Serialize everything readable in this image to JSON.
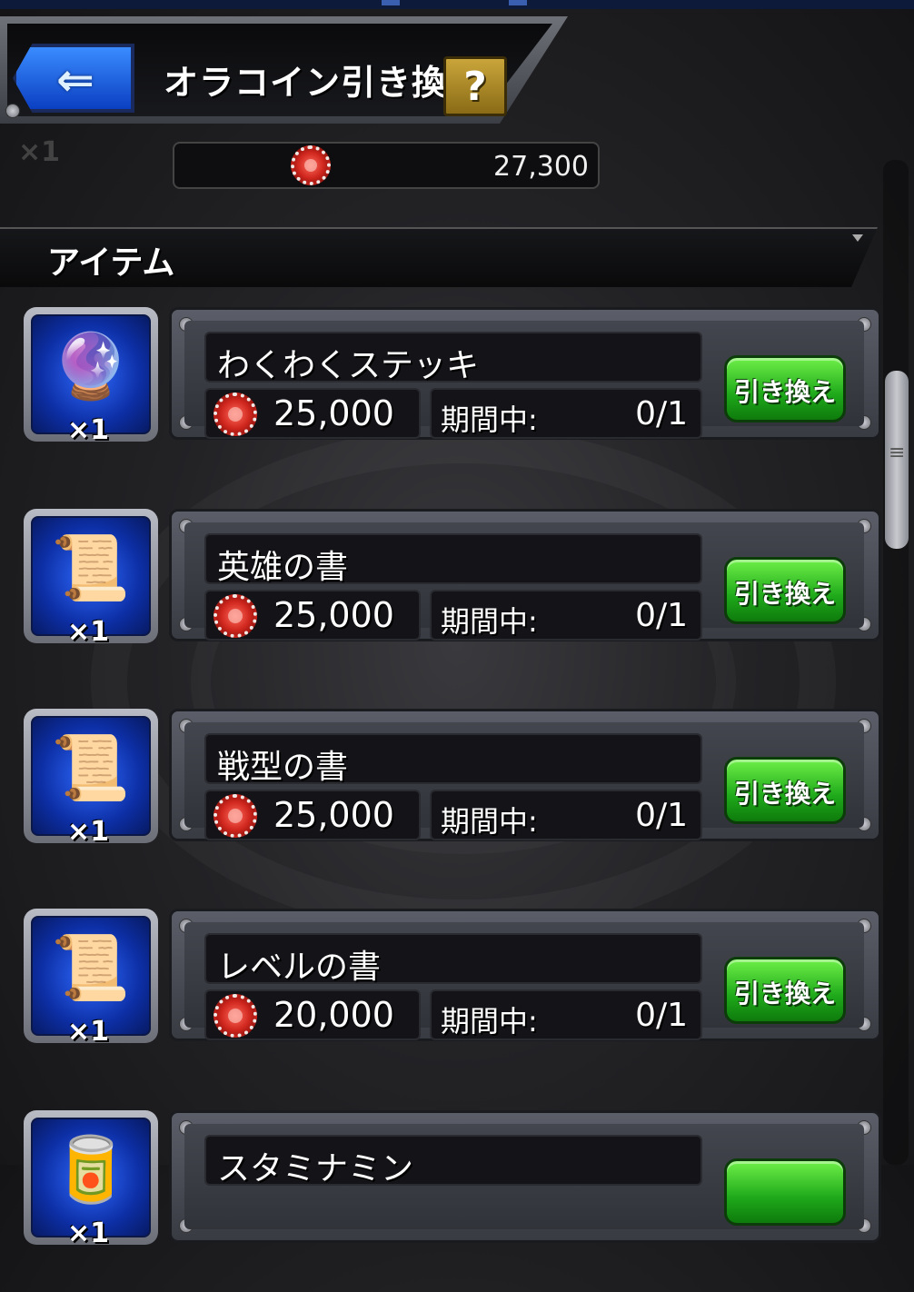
{
  "header": {
    "title": "オラコイン引き換え",
    "back_icon": "back-arrow-icon",
    "help_label": "?"
  },
  "currency": {
    "icon": "orb-coin-icon",
    "amount": "27,300",
    "partial_qty": "×1"
  },
  "section": {
    "label": "アイテム"
  },
  "items": [
    {
      "name": "わくわくステッキ",
      "qty": "×1",
      "icon": "wand-icon",
      "price": "25,000",
      "period_label": "期間中:",
      "period_value": "0/1",
      "button_label": "引き換え"
    },
    {
      "name": "英雄の書",
      "qty": "×1",
      "icon": "scroll-hero-icon",
      "price": "25,000",
      "period_label": "期間中:",
      "period_value": "0/1",
      "button_label": "引き換え"
    },
    {
      "name": "戦型の書",
      "qty": "×1",
      "icon": "scroll-tactics-icon",
      "price": "25,000",
      "period_label": "期間中:",
      "period_value": "0/1",
      "button_label": "引き換え"
    },
    {
      "name": "レベルの書",
      "qty": "×1",
      "icon": "scroll-level-icon",
      "price": "20,000",
      "period_label": "期間中:",
      "period_value": "0/1",
      "button_label": "引き換え"
    },
    {
      "name": "スタミナミン",
      "qty": "×1",
      "icon": "stamina-can-icon",
      "price": "",
      "period_label": "",
      "period_value": "",
      "button_label": ""
    }
  ],
  "colors": {
    "accent_green": "#1ea81a",
    "back_blue": "#1f5fe6",
    "coin_red": "#d0271e"
  }
}
